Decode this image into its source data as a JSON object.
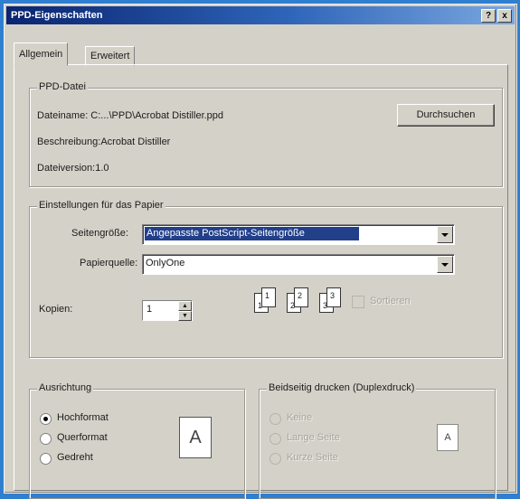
{
  "window": {
    "title": "PPD-Eigenschaften",
    "help_btn": "?",
    "close_btn": "x"
  },
  "tabs": [
    {
      "label": "Allgemein"
    },
    {
      "label": "Erweitert"
    }
  ],
  "ppd": {
    "legend": "PPD-Datei",
    "filename": "Dateiname:  C:...\\PPD\\Acrobat Distiller.ppd",
    "browse": "Durchsuchen",
    "description": "Beschreibung:Acrobat Distiller",
    "version": "Dateiversion:1.0"
  },
  "paper": {
    "legend": "Einstellungen für das Papier",
    "size_label": "Seitengröße:",
    "size_value": "Angepasste PostScript-Seitengröße",
    "source_label": "Papierquelle:",
    "source_value": "OnlyOne",
    "copies_label": "Kopien:",
    "copies_value": "1",
    "collate_label": "Sortieren",
    "collate_pages": [
      "1",
      "1",
      "2",
      "2",
      "3",
      "3"
    ]
  },
  "orientation": {
    "legend": "Ausrichtung",
    "options": [
      "Hochformat",
      "Querformat",
      "Gedreht"
    ],
    "preview": "A"
  },
  "duplex": {
    "legend": "Beidseitig drucken (Duplexdruck)",
    "options": [
      "Keine",
      "Lange Seite",
      "Kurze Seite"
    ],
    "preview": "A"
  },
  "colors": {
    "title_start": "#0a2470",
    "selection": "#223f8a",
    "desktop": "#2f7fd0"
  }
}
